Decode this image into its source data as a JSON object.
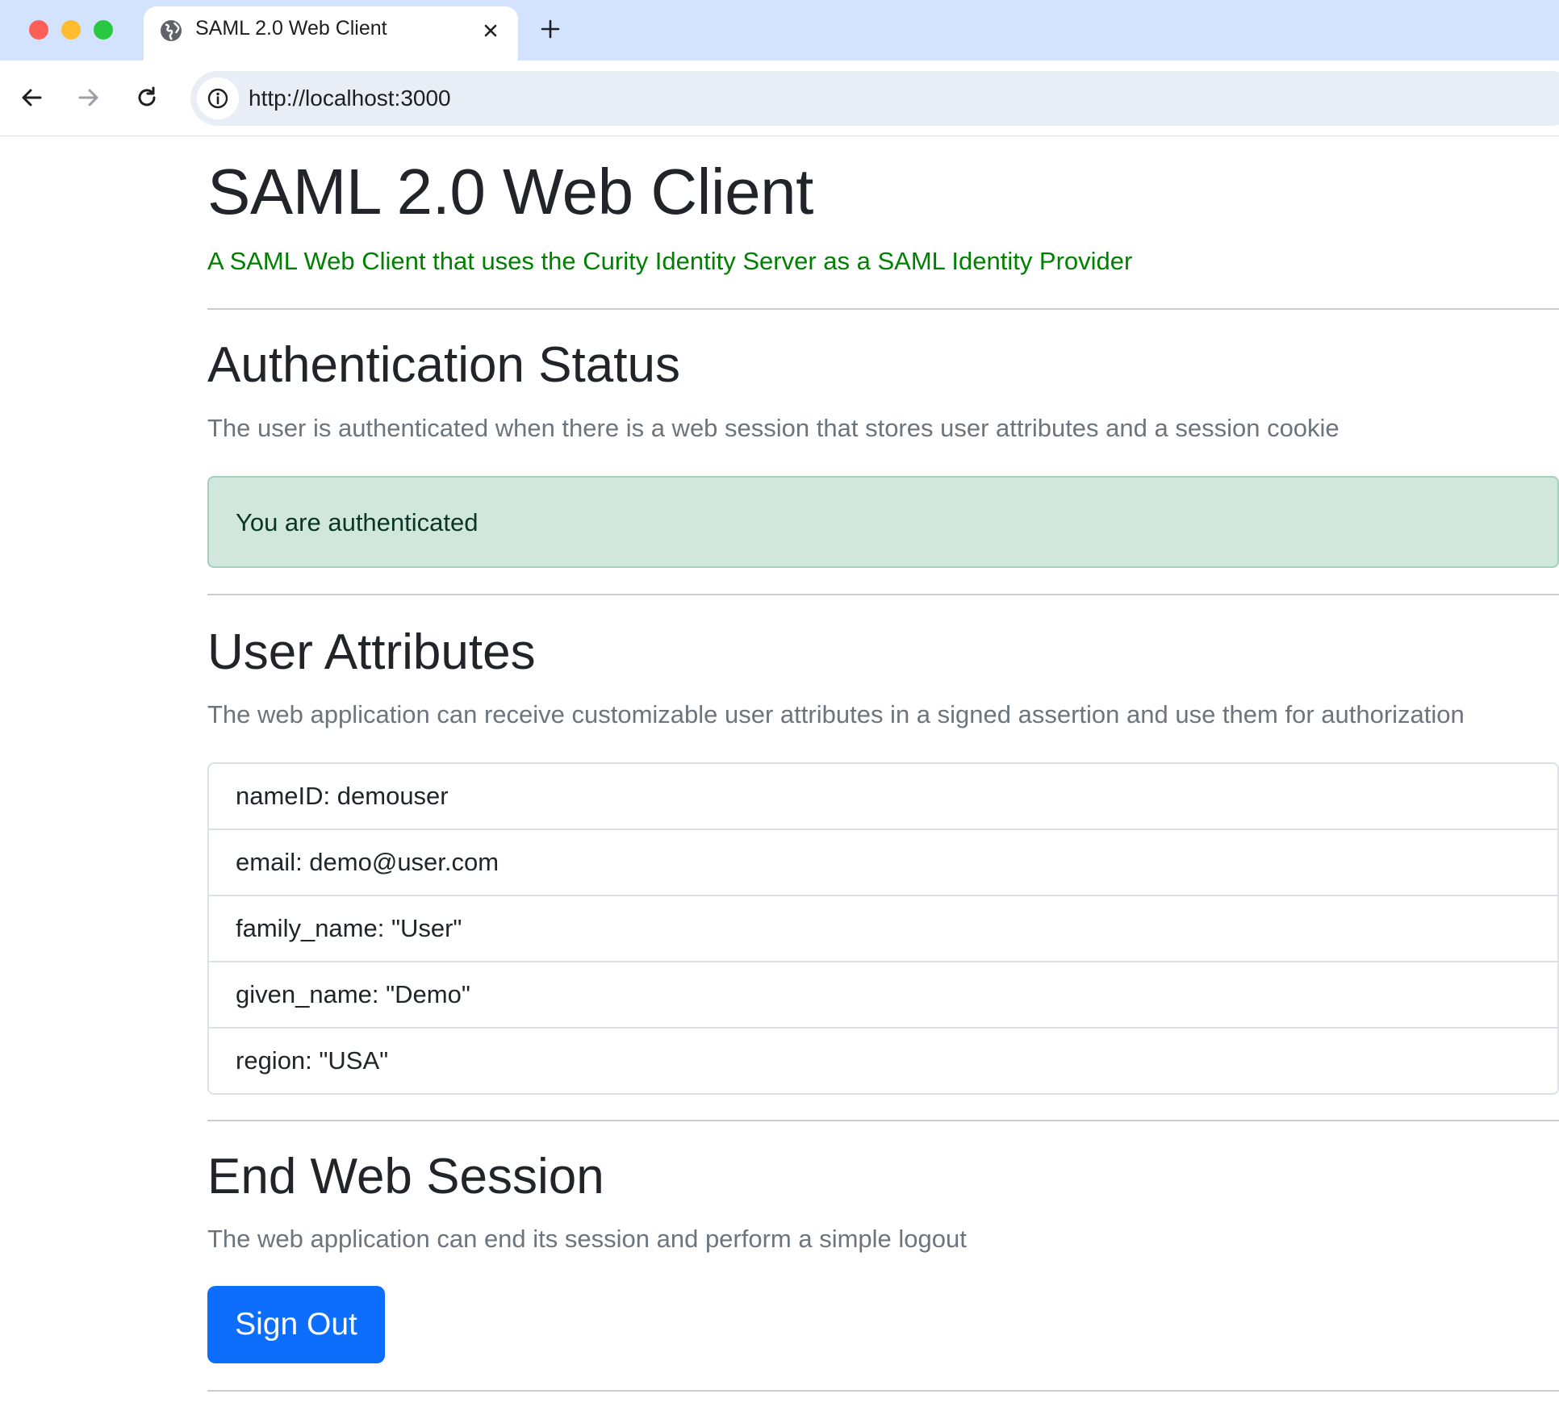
{
  "browser": {
    "tab_title": "SAML 2.0 Web Client",
    "url": "http://localhost:3000",
    "icons": {
      "tab_favicon": "globe-icon",
      "tab_close": "close-icon",
      "new_tab": "plus-icon",
      "back": "arrow-left-icon",
      "forward": "arrow-right-icon",
      "reload": "reload-icon",
      "site_info": "info-icon"
    }
  },
  "page": {
    "title": "SAML 2.0 Web Client",
    "subtitle": "A SAML Web Client that uses the Curity Identity Server as a SAML Identity Provider",
    "subtitle_color": "#008000",
    "auth_status": {
      "heading": "Authentication Status",
      "description": "The user is authenticated when there is a web session that stores user attributes and a session cookie",
      "alert_text": "You are authenticated",
      "alert_color": "#d1e7dd"
    },
    "user_attributes": {
      "heading": "User Attributes",
      "description": "The web application can receive customizable user attributes in a signed assertion and use them for authorization",
      "items": [
        "nameID: demouser",
        "email: demo@user.com",
        "family_name: \"User\"",
        "given_name: \"Demo\"",
        "region: \"USA\""
      ]
    },
    "end_session": {
      "heading": "End Web Session",
      "description": "The web application can end its session and perform a simple logout",
      "button_label": "Sign Out",
      "button_color": "#0d6efd"
    }
  }
}
